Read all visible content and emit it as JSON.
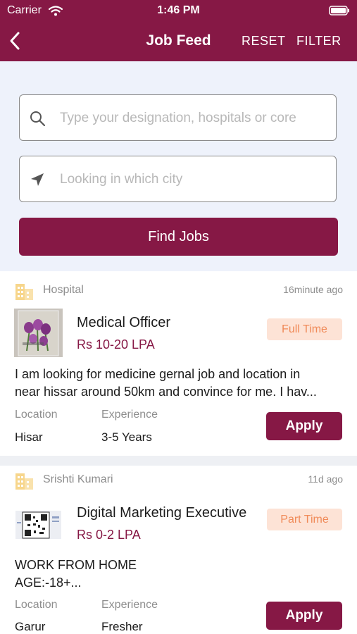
{
  "status_bar": {
    "carrier": "Carrier",
    "time": "1:46 PM"
  },
  "nav": {
    "title": "Job Feed",
    "reset_label": "RESET",
    "filter_label": "FILTER"
  },
  "search": {
    "keyword_placeholder": "Type your designation, hospitals or core",
    "city_placeholder": "Looking in which city",
    "find_label": "Find Jobs"
  },
  "jobs": [
    {
      "org_name": "Hospital",
      "posted": "16minute ago",
      "title": "Medical Officer",
      "salary": "Rs 10-20 LPA",
      "type": "Full Time",
      "description_line1": "I am looking for medicine gernal job and location in",
      "description_line2": "near hissar around 50km and convince for me. I hav...",
      "location_label": "Location",
      "location": "Hisar",
      "experience_label": "Experience",
      "experience": "3-5 Years",
      "apply_label": "Apply"
    },
    {
      "org_name": "Srishti Kumari",
      "posted": "11d ago",
      "title": "Digital Marketing Executive",
      "salary": "Rs 0-2 LPA",
      "type": "Part Time",
      "description_line1": "WORK FROM HOME",
      "description_line2": "AGE:-18+...",
      "location_label": "Location",
      "location": "Garur",
      "experience_label": "Experience",
      "experience": "Fresher",
      "apply_label": "Apply"
    }
  ],
  "colors": {
    "brand": "#861845",
    "badge_bg": "#fde3d6",
    "badge_text": "#f08a58"
  }
}
